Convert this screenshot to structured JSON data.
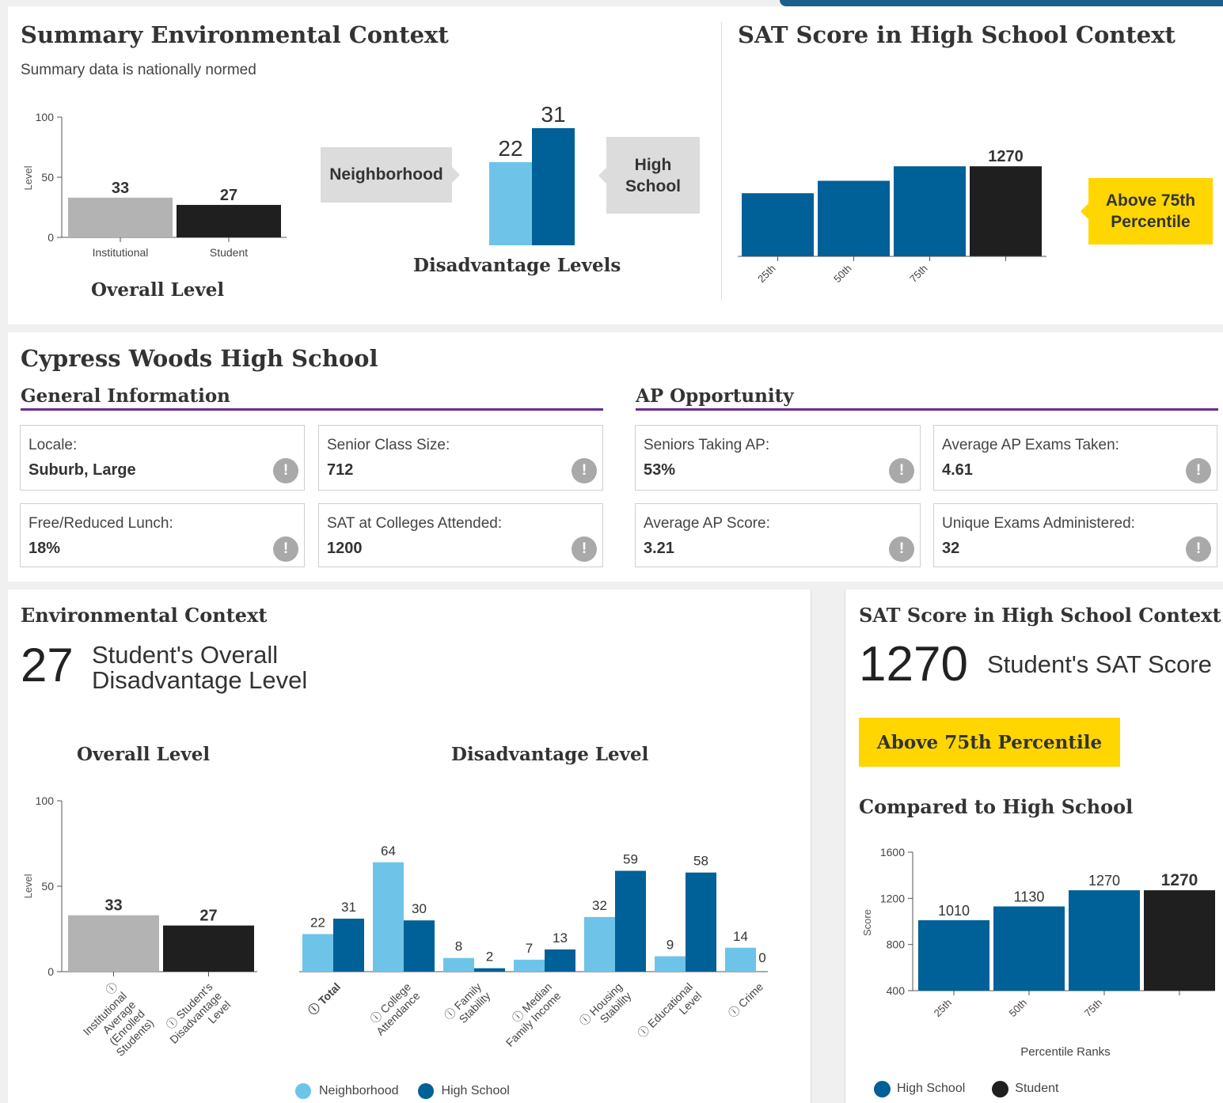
{
  "summary": {
    "title": "Summary Environmental Context",
    "subtitle": "Summary data is nationally normed",
    "overall_caption": "Overall Level",
    "dis_caption": "Disadvantage Levels",
    "neighborhood_label": "Neighborhood",
    "high_school_label": "High School",
    "sat_title": "SAT Score in High School Context",
    "sat_badge": "Above 75th Percentile"
  },
  "school": {
    "name": "Cypress Woods High School",
    "general_header": "General Information",
    "ap_header": "AP Opportunity",
    "general": [
      {
        "label": "Locale:",
        "value": "Suburb, Large"
      },
      {
        "label": "Senior Class Size:",
        "value": "712"
      },
      {
        "label": "Free/Reduced Lunch:",
        "value": "18%"
      },
      {
        "label": "SAT at Colleges Attended:",
        "value": "1200"
      }
    ],
    "ap": [
      {
        "label": "Seniors Taking AP:",
        "value": "53%"
      },
      {
        "label": "Average AP Exams Taken:",
        "value": "4.61"
      },
      {
        "label": "Average AP Score:",
        "value": "3.21"
      },
      {
        "label": "Unique Exams Administered:",
        "value": "32"
      }
    ],
    "info_icon": "!"
  },
  "env": {
    "title": "Environmental Context",
    "big_number": "27",
    "big_text_1": "Student's Overall",
    "big_text_2": "Disadvantage Level",
    "overall_caption": "Overall Level",
    "dis_caption": "Disadvantage Level",
    "legend_neighborhood": "Neighborhood",
    "legend_high_school": "High School"
  },
  "sat": {
    "title": "SAT Score in High School Context",
    "big_number": "1270",
    "big_text": "Student's SAT Score",
    "badge": "Above 75th Percentile",
    "compared": "Compared to High School",
    "legend_high_school": "High School",
    "legend_student": "Student"
  },
  "colors": {
    "neighborhood": "#6ec4e8",
    "high_school": "#006098",
    "student": "#1f1f1f",
    "institutional": "#b3b3b3",
    "badge": "#ffd600",
    "rule": "#6b2c91"
  },
  "chart_data": [
    {
      "id": "summary-overall",
      "type": "bar",
      "categories": [
        "Institutional",
        "Student"
      ],
      "values": [
        33,
        27
      ],
      "ylabel": "Level",
      "ylim": [
        0,
        100
      ],
      "yticks": [
        0,
        50,
        100
      ]
    },
    {
      "id": "summary-disadvantage",
      "type": "bar",
      "series": [
        {
          "name": "Neighborhood",
          "values": [
            22
          ]
        },
        {
          "name": "High School",
          "values": [
            31
          ]
        }
      ],
      "ylim": [
        0,
        31
      ]
    },
    {
      "id": "summary-sat",
      "type": "bar",
      "categories": [
        "25th",
        "50th",
        "75th",
        ""
      ],
      "values": [
        1010,
        1130,
        1270,
        1270
      ],
      "labels": [
        "",
        "",
        "",
        "1270"
      ],
      "ylim": [
        400,
        1600
      ]
    },
    {
      "id": "env-overall",
      "type": "bar",
      "categories": [
        "ⓘ Institutional Average (Enrolled Students)",
        "ⓘ Student's Disadvantage Level"
      ],
      "values": [
        33,
        27
      ],
      "ylabel": "Level",
      "ylim": [
        0,
        100
      ],
      "yticks": [
        0,
        50,
        100
      ]
    },
    {
      "id": "env-disadvantage",
      "type": "bar",
      "categories": [
        "ⓘ Total",
        "ⓘ College Attendance",
        "ⓘ Family Stability",
        "ⓘ Median Family Income",
        "ⓘ Housing Stability",
        "ⓘ Educational Level",
        "ⓘ Crime"
      ],
      "series": [
        {
          "name": "Neighborhood",
          "values": [
            22,
            64,
            8,
            7,
            32,
            9,
            14
          ]
        },
        {
          "name": "High School",
          "values": [
            31,
            30,
            2,
            13,
            59,
            58,
            0
          ]
        }
      ],
      "ylim": [
        0,
        100
      ]
    },
    {
      "id": "sat-compared",
      "type": "bar",
      "categories": [
        "25th",
        "50th",
        "75th",
        ""
      ],
      "values": [
        1010,
        1130,
        1270,
        1270
      ],
      "ylabel": "Score",
      "xlabel": "Percentile Ranks",
      "ylim": [
        400,
        1600
      ],
      "yticks": [
        400,
        800,
        1200,
        1600
      ]
    }
  ]
}
